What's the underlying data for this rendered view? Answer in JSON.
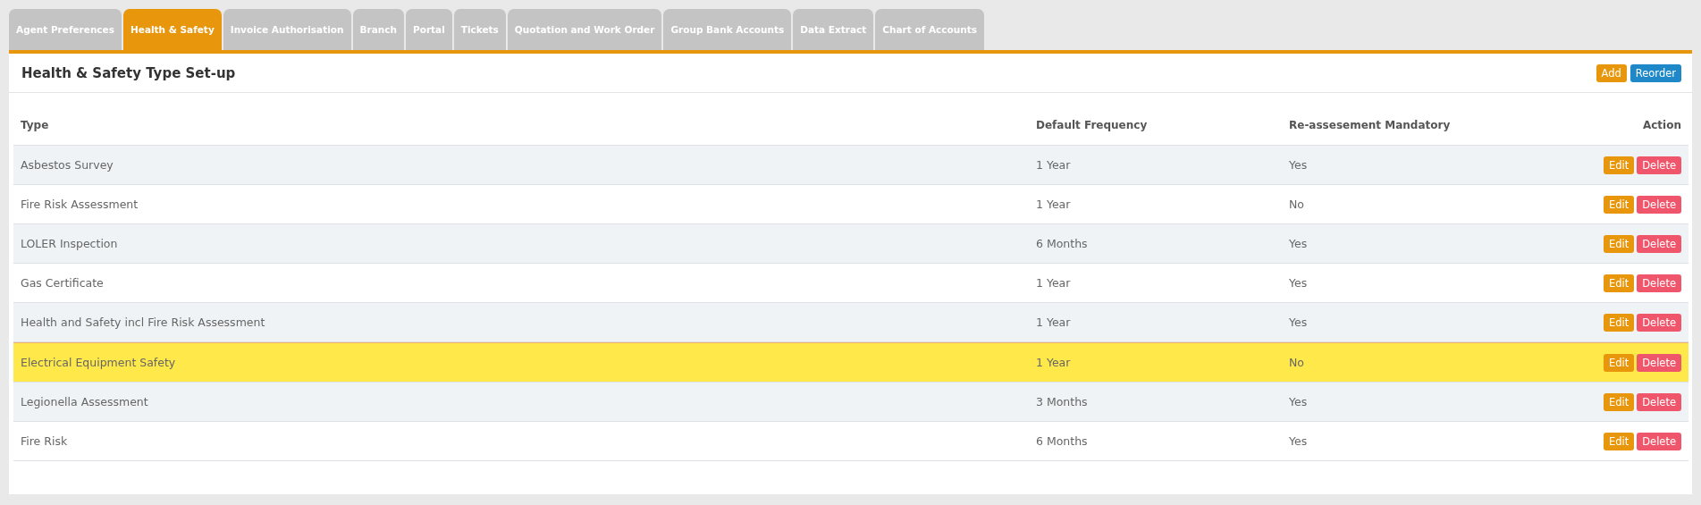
{
  "tabs": [
    {
      "label": "Agent Preferences",
      "selected": false
    },
    {
      "label": "Health & Safety",
      "selected": true
    },
    {
      "label": "Invoice Authorisation",
      "selected": false
    },
    {
      "label": "Branch",
      "selected": false
    },
    {
      "label": "Portal",
      "selected": false
    },
    {
      "label": "Tickets",
      "selected": false
    },
    {
      "label": "Quotation and Work Order",
      "selected": false
    },
    {
      "label": "Group Bank Accounts",
      "selected": false
    },
    {
      "label": "Data Extract",
      "selected": false
    },
    {
      "label": "Chart of Accounts",
      "selected": false
    }
  ],
  "panel": {
    "title": "Health & Safety Type Set-up",
    "buttons": [
      {
        "label": "Add",
        "kind": "warning"
      },
      {
        "label": "Reorder",
        "kind": "primary"
      }
    ]
  },
  "table": {
    "columns": [
      "Type",
      "Default Frequency",
      "Re-assesement Mandatory",
      "Action"
    ],
    "rows": [
      {
        "type": "Asbestos Survey",
        "frequency": "1 Year",
        "mandatory": "Yes",
        "highlighted": false,
        "actions": [
          {
            "label": "Edit",
            "kind": "warning"
          },
          {
            "label": "Delete",
            "kind": "danger"
          }
        ]
      },
      {
        "type": "Fire Risk Assessment",
        "frequency": "1 Year",
        "mandatory": "No",
        "highlighted": false,
        "actions": [
          {
            "label": "Edit",
            "kind": "warning"
          },
          {
            "label": "Delete",
            "kind": "danger"
          }
        ]
      },
      {
        "type": "LOLER Inspection",
        "frequency": "6 Months",
        "mandatory": "Yes",
        "highlighted": false,
        "actions": [
          {
            "label": "Edit",
            "kind": "warning"
          },
          {
            "label": "Delete",
            "kind": "danger"
          }
        ]
      },
      {
        "type": "Gas Certificate",
        "frequency": "1 Year",
        "mandatory": "Yes",
        "highlighted": false,
        "actions": [
          {
            "label": "Edit",
            "kind": "warning"
          },
          {
            "label": "Delete",
            "kind": "danger"
          }
        ]
      },
      {
        "type": "Health and Safety incl Fire Risk Assessment",
        "frequency": "1 Year",
        "mandatory": "Yes",
        "highlighted": false,
        "actions": [
          {
            "label": "Edit",
            "kind": "warning"
          },
          {
            "label": "Delete",
            "kind": "danger"
          }
        ]
      },
      {
        "type": "Electrical Equipment Safety",
        "frequency": "1 Year",
        "mandatory": "No",
        "highlighted": true,
        "actions": [
          {
            "label": "Edit",
            "kind": "warning"
          },
          {
            "label": "Delete",
            "kind": "danger"
          }
        ]
      },
      {
        "type": "Legionella Assessment",
        "frequency": "3 Months",
        "mandatory": "Yes",
        "highlighted": false,
        "actions": [
          {
            "label": "Edit",
            "kind": "warning"
          },
          {
            "label": "Delete",
            "kind": "danger"
          }
        ]
      },
      {
        "type": "Fire Risk",
        "frequency": "6 Months",
        "mandatory": "Yes",
        "highlighted": false,
        "actions": [
          {
            "label": "Edit",
            "kind": "warning"
          },
          {
            "label": "Delete",
            "kind": "danger"
          }
        ]
      }
    ]
  }
}
